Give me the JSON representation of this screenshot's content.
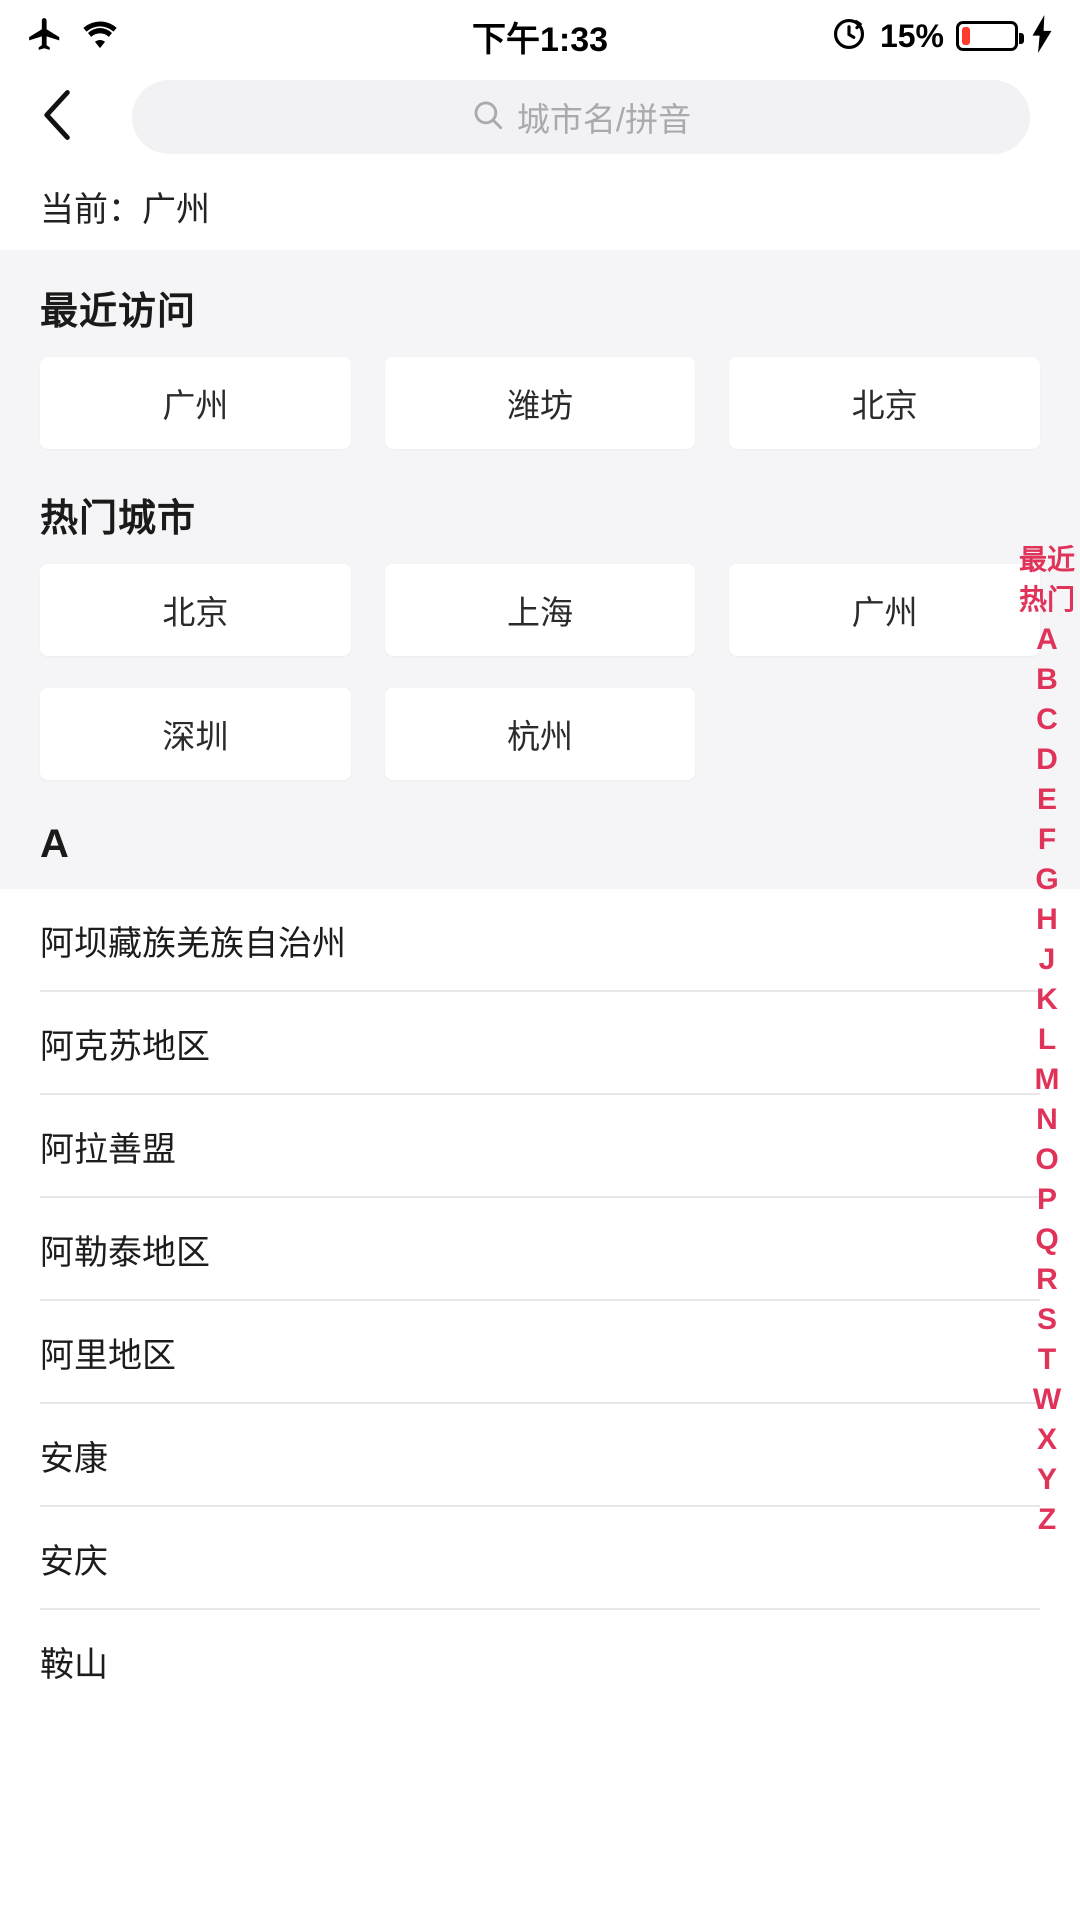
{
  "status_bar": {
    "airplane_icon": "airplane-mode-icon",
    "wifi_icon": "wifi-icon",
    "time": "下午1:33",
    "rotation_lock_icon": "rotation-lock-icon",
    "battery_percent": "15%",
    "battery_level": 15,
    "charging_icon": "lightning-bolt-icon"
  },
  "header": {
    "back_icon": "chevron-left-icon",
    "search_icon": "search-icon",
    "search_placeholder": "城市名/拼音",
    "search_value": ""
  },
  "current": {
    "label": "当前：",
    "city": "广州",
    "full": "当前：广州"
  },
  "recent": {
    "title": "最近访问",
    "cities": [
      "广州",
      "潍坊",
      "北京"
    ]
  },
  "hot": {
    "title": "热门城市",
    "cities": [
      "北京",
      "上海",
      "广州",
      "深圳",
      "杭州"
    ]
  },
  "section": {
    "letter": "A"
  },
  "city_list": [
    "阿坝藏族羌族自治州",
    "阿克苏地区",
    "阿拉善盟",
    "阿勒泰地区",
    "阿里地区",
    "安康",
    "安庆",
    "鞍山"
  ],
  "index_rail": {
    "accent_color": "#e0335a",
    "items": [
      "最近",
      "热门",
      "A",
      "B",
      "C",
      "D",
      "E",
      "F",
      "G",
      "H",
      "J",
      "K",
      "L",
      "M",
      "N",
      "O",
      "P",
      "Q",
      "R",
      "S",
      "T",
      "W",
      "X",
      "Y",
      "Z"
    ]
  }
}
